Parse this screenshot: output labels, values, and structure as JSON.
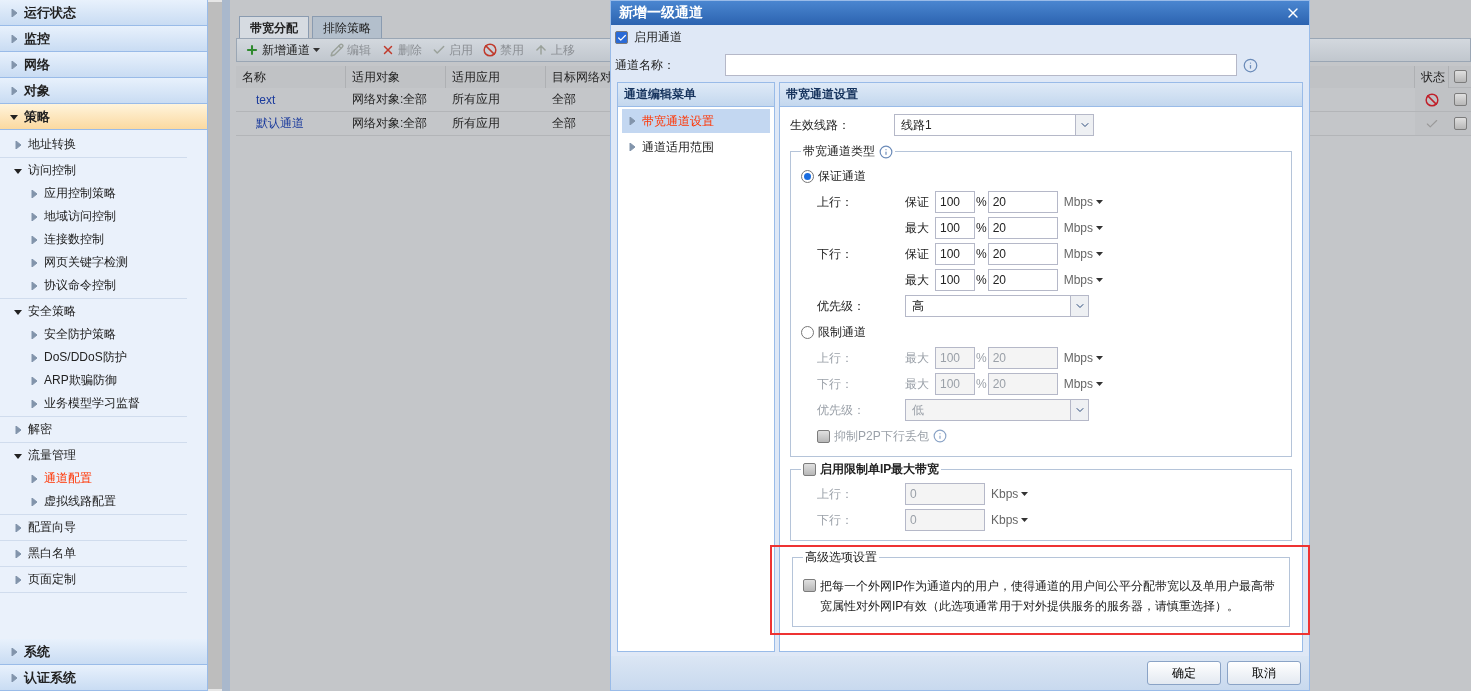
{
  "sidebar": {
    "sections": [
      {
        "label": "运行状态",
        "expanded": false,
        "selected": false
      },
      {
        "label": "监控",
        "expanded": false,
        "selected": false
      },
      {
        "label": "网络",
        "expanded": false,
        "selected": false
      },
      {
        "label": "对象",
        "expanded": false,
        "selected": false
      },
      {
        "label": "策略",
        "expanded": true,
        "selected": true,
        "children": [
          {
            "label": "地址转换",
            "selected": false
          },
          {
            "label": "访问控制",
            "expanded": true,
            "children": [
              {
                "label": "应用控制策略",
                "selected": false
              },
              {
                "label": "地域访问控制",
                "selected": false
              },
              {
                "label": "连接数控制",
                "selected": false
              },
              {
                "label": "网页关键字检测",
                "selected": false
              },
              {
                "label": "协议命令控制",
                "selected": false
              }
            ]
          },
          {
            "label": "安全策略",
            "expanded": true,
            "children": [
              {
                "label": "安全防护策略",
                "selected": false
              },
              {
                "label": "DoS/DDoS防护",
                "selected": false
              },
              {
                "label": "ARP欺骗防御",
                "selected": false
              },
              {
                "label": "业务模型学习监督",
                "selected": false
              }
            ]
          },
          {
            "label": "解密",
            "selected": false
          },
          {
            "label": "流量管理",
            "expanded": true,
            "children": [
              {
                "label": "通道配置",
                "selected": true
              },
              {
                "label": "虚拟线路配置",
                "selected": false
              }
            ]
          },
          {
            "label": "配置向导",
            "selected": false
          },
          {
            "label": "黑白名单",
            "selected": false
          },
          {
            "label": "页面定制",
            "selected": false
          }
        ]
      },
      {
        "label": "系统",
        "expanded": false,
        "selected": false
      },
      {
        "label": "认证系统",
        "expanded": false,
        "selected": false
      }
    ]
  },
  "main": {
    "tabs": [
      {
        "label": "带宽分配",
        "selected": true
      },
      {
        "label": "排除策略",
        "selected": false
      }
    ],
    "toolbar": [
      {
        "kind": "add",
        "label": "新增通道",
        "disabled": false
      },
      {
        "kind": "edit",
        "label": "编辑",
        "disabled": true
      },
      {
        "kind": "delete",
        "label": "删除",
        "disabled": true
      },
      {
        "kind": "enable",
        "label": "启用",
        "disabled": true
      },
      {
        "kind": "disable",
        "label": "禁用",
        "disabled": true
      },
      {
        "kind": "move-up",
        "label": "上移",
        "disabled": true
      }
    ],
    "table": {
      "columns": [
        "名称",
        "适用对象",
        "适用应用",
        "目标网络对",
        "状态"
      ],
      "select_all": false,
      "rows": [
        {
          "cells": [
            "text",
            "网络对象:全部",
            "所有应用",
            "全部"
          ],
          "enabled": false,
          "selected": false
        },
        {
          "cells": [
            "默认通道",
            "网络对象:全部",
            "所有应用",
            "全部"
          ],
          "enabled": true,
          "selected": false
        }
      ]
    }
  },
  "dialog": {
    "title": "新增一级通道",
    "enable": {
      "label": "启用通道",
      "checked": true
    },
    "name_field": {
      "label": "通道名称："
    },
    "menu": {
      "title": "通道编辑菜单",
      "items": [
        {
          "label": "带宽通道设置",
          "selected": true
        },
        {
          "label": "通道适用范围",
          "selected": false
        }
      ]
    },
    "panel": {
      "title": "带宽通道设置",
      "line": {
        "label": "生效线路：",
        "value": "线路1"
      },
      "type_group": {
        "legend": "带宽通道类型",
        "options": [
          {
            "label": "保证通道",
            "selected": true,
            "rows": [
              {
                "direction": "上行：",
                "limits": [
                  {
                    "label": "保证",
                    "percent": "100",
                    "sign": "%",
                    "value": "20",
                    "unit": "Mbps"
                  },
                  {
                    "label": "最大",
                    "percent": "100",
                    "sign": "%",
                    "value": "20",
                    "unit": "Mbps"
                  }
                ]
              },
              {
                "direction": "下行：",
                "limits": [
                  {
                    "label": "保证",
                    "percent": "100",
                    "sign": "%",
                    "value": "20",
                    "unit": "Mbps"
                  },
                  {
                    "label": "最大",
                    "percent": "100",
                    "sign": "%",
                    "value": "20",
                    "unit": "Mbps"
                  }
                ]
              }
            ],
            "priority": {
              "label": "优先级：",
              "value": "高"
            }
          },
          {
            "label": "限制通道",
            "selected": false,
            "rows": [
              {
                "direction": "上行：",
                "limits": [
                  {
                    "label": "最大",
                    "percent": "100",
                    "sign": "%",
                    "value": "20",
                    "unit": "Mbps"
                  }
                ]
              },
              {
                "direction": "下行：",
                "limits": [
                  {
                    "label": "最大",
                    "percent": "100",
                    "sign": "%",
                    "value": "20",
                    "unit": "Mbps"
                  }
                ]
              }
            ],
            "priority": {
              "label": "优先级：",
              "value": "低"
            },
            "p2p": {
              "label": "抑制P2P下行丢包",
              "checked": false
            }
          }
        ]
      },
      "ip_limit": {
        "label": "启用限制单IP最大带宽",
        "checked": false,
        "rows": [
          {
            "label": "上行：",
            "value": "0",
            "unit": "Kbps"
          },
          {
            "label": "下行：",
            "value": "0",
            "unit": "Kbps"
          }
        ]
      },
      "advanced": {
        "legend": "高级选项设置",
        "highlighted": true,
        "checked": false,
        "text": "把每一个外网IP作为通道内的用户，使得通道的用户间公平分配带宽以及单用户最高带宽属性对外网IP有效（此选项通常用于对外提供服务的服务器，请慎重选择）。"
      }
    },
    "buttons": [
      "确定",
      "取消"
    ]
  }
}
